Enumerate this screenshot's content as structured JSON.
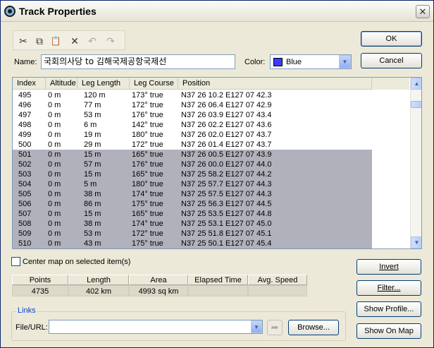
{
  "window": {
    "title": "Track Properties",
    "close_label": "✕"
  },
  "toolbar": {
    "cut_glyph": "✂",
    "copy_glyph": "⧉",
    "paste_glyph": "📋",
    "delete_glyph": "✕",
    "undo_glyph": "↶",
    "redo_glyph": "↷"
  },
  "form": {
    "name_label": "Name:",
    "name_value": "국회의사당 to 김해국제공항국제선",
    "color_label": "Color:",
    "color_value": "Blue",
    "color_swatch": "#3c3cff"
  },
  "buttons": {
    "ok": "OK",
    "cancel": "Cancel",
    "invert": "Invert",
    "filter": "Filter...",
    "show_profile": "Show Profile...",
    "show_on_map": "Show On Map",
    "browse": "Browse..."
  },
  "table": {
    "columns": [
      "Index",
      "Altitude",
      "Leg Length",
      "Leg Course",
      "Position"
    ],
    "rows": [
      {
        "index": "495",
        "altitude": "0 m",
        "leg_length": "120 m",
        "leg_course": "173° true",
        "position": "N37 26 10.2 E127 07 42.3",
        "selected": false
      },
      {
        "index": "496",
        "altitude": "0 m",
        "leg_length": "77 m",
        "leg_course": "172° true",
        "position": "N37 26 06.4 E127 07 42.9",
        "selected": false
      },
      {
        "index": "497",
        "altitude": "0 m",
        "leg_length": "53 m",
        "leg_course": "176° true",
        "position": "N37 26 03.9 E127 07 43.4",
        "selected": false
      },
      {
        "index": "498",
        "altitude": "0 m",
        "leg_length": "6 m",
        "leg_course": "142° true",
        "position": "N37 26 02.2 E127 07 43.6",
        "selected": false
      },
      {
        "index": "499",
        "altitude": "0 m",
        "leg_length": "19 m",
        "leg_course": "180° true",
        "position": "N37 26 02.0 E127 07 43.7",
        "selected": false
      },
      {
        "index": "500",
        "altitude": "0 m",
        "leg_length": "29 m",
        "leg_course": "172° true",
        "position": "N37 26 01.4 E127 07 43.7",
        "selected": false
      },
      {
        "index": "501",
        "altitude": "0 m",
        "leg_length": "15 m",
        "leg_course": "165° true",
        "position": "N37 26 00.5 E127 07 43.9",
        "selected": true
      },
      {
        "index": "502",
        "altitude": "0 m",
        "leg_length": "57 m",
        "leg_course": "176° true",
        "position": "N37 26 00.0 E127 07 44.0",
        "selected": true
      },
      {
        "index": "503",
        "altitude": "0 m",
        "leg_length": "15 m",
        "leg_course": "165° true",
        "position": "N37 25 58.2 E127 07 44.2",
        "selected": true
      },
      {
        "index": "504",
        "altitude": "0 m",
        "leg_length": "5 m",
        "leg_course": "180° true",
        "position": "N37 25 57.7 E127 07 44.3",
        "selected": true
      },
      {
        "index": "505",
        "altitude": "0 m",
        "leg_length": "38 m",
        "leg_course": "174° true",
        "position": "N37 25 57.5 E127 07 44.3",
        "selected": true
      },
      {
        "index": "506",
        "altitude": "0 m",
        "leg_length": "86 m",
        "leg_course": "175° true",
        "position": "N37 25 56.3 E127 07 44.5",
        "selected": true
      },
      {
        "index": "507",
        "altitude": "0 m",
        "leg_length": "15 m",
        "leg_course": "165° true",
        "position": "N37 25 53.5 E127 07 44.8",
        "selected": true
      },
      {
        "index": "508",
        "altitude": "0 m",
        "leg_length": "38 m",
        "leg_course": "174° true",
        "position": "N37 25 53.1 E127 07 45.0",
        "selected": true
      },
      {
        "index": "509",
        "altitude": "0 m",
        "leg_length": "53 m",
        "leg_course": "172° true",
        "position": "N37 25 51.8 E127 07 45.1",
        "selected": true
      },
      {
        "index": "510",
        "altitude": "0 m",
        "leg_length": "43 m",
        "leg_course": "175° true",
        "position": "N37 25 50.1 E127 07 45.4",
        "selected": true
      }
    ]
  },
  "center_map_label": "Center map on selected item(s)",
  "stats": {
    "headers": [
      "Points",
      "Length",
      "Area",
      "Elapsed Time",
      "Avg. Speed"
    ],
    "values": [
      "4735",
      "402 km",
      "4993 sq km",
      "",
      ""
    ]
  },
  "links": {
    "group_label": "Links",
    "file_url_label": "File/URL:",
    "file_url_value": ""
  }
}
